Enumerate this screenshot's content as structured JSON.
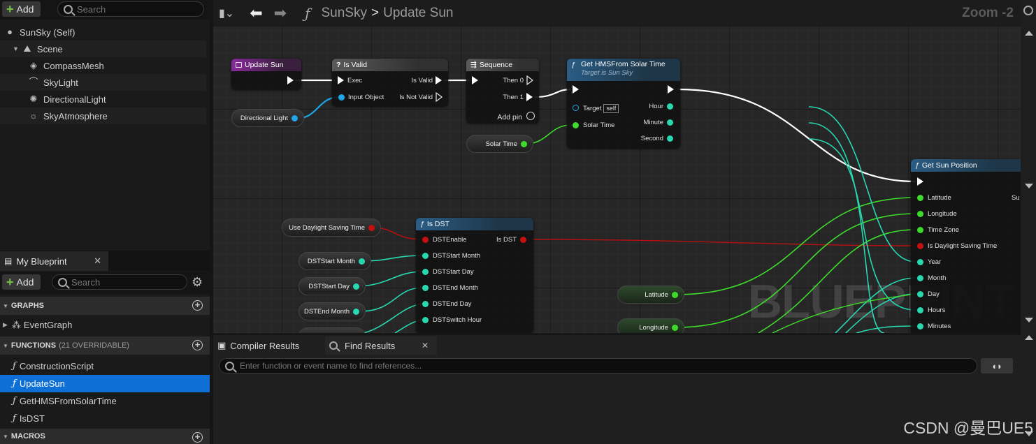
{
  "left_toolbar": {
    "add_label": "Add",
    "search_placeholder": "Search"
  },
  "components": [
    {
      "label": "SunSky (Self)",
      "icon": "person-icon"
    },
    {
      "label": "Scene",
      "icon": "scene-icon"
    },
    {
      "label": "CompassMesh",
      "icon": "cube-icon"
    },
    {
      "label": "SkyLight",
      "icon": "skylight-icon"
    },
    {
      "label": "DirectionalLight",
      "icon": "sun-icon"
    },
    {
      "label": "SkyAtmosphere",
      "icon": "atmosphere-icon"
    }
  ],
  "my_blueprint": {
    "tab_label": "My Blueprint",
    "add_label": "Add",
    "search_placeholder": "Search",
    "graphs_header": "GRAPHS",
    "graphs": [
      "EventGraph"
    ],
    "functions_header": "FUNCTIONS",
    "functions_sub": "(21 OVERRIDABLE)",
    "functions": [
      "ConstructionScript",
      "UpdateSun",
      "GetHMSFromSolarTime",
      "IsDST"
    ],
    "macros_header": "MACROS"
  },
  "graph_toolbar": {
    "crumb_root": "SunSky",
    "crumb_sep": ">",
    "crumb_current": "Update Sun",
    "zoom": "Zoom -2"
  },
  "nodes": {
    "update_sun": {
      "title": "Update Sun"
    },
    "is_valid": {
      "title": "Is Valid",
      "exec": "Exec",
      "input_object": "Input Object",
      "is_valid": "Is Valid",
      "is_not_valid": "Is Not Valid"
    },
    "sequence": {
      "title": "Sequence",
      "then0": "Then 0",
      "then1": "Then 1",
      "add_pin": "Add pin"
    },
    "get_hms": {
      "title": "Get HMSFrom Solar Time",
      "subtitle": "Target is Sun Sky",
      "target": "Target",
      "self": "self",
      "solar_time": "Solar Time",
      "hour": "Hour",
      "minute": "Minute",
      "second": "Second"
    },
    "is_dst": {
      "title": "Is DST",
      "dst_enable": "DSTEnable",
      "is_dst": "Is DST",
      "start_month": "DSTStart Month",
      "start_day": "DSTStart Day",
      "end_month": "DSTEnd Month",
      "end_day": "DSTEnd Day",
      "switch_hour": "DSTSwitch Hour"
    },
    "get_sun_position": {
      "title": "Get Sun Position",
      "latitude": "Latitude",
      "longitude": "Longitude",
      "time_zone": "Time Zone",
      "daylight": "Is Daylight Saving Time",
      "year": "Year",
      "month": "Month",
      "day": "Day",
      "hours": "Hours",
      "minutes": "Minutes",
      "out_partial": "Su"
    }
  },
  "variables": {
    "directional_light": "Directional Light",
    "solar_time": "Solar Time",
    "use_dst": "Use Daylight Saving Time",
    "dst_start_month": "DSTStart Month",
    "dst_start_day": "DSTStart Day",
    "dst_end_month": "DSTEnd Month",
    "latitude": "Latitude",
    "longitude": "Longitude"
  },
  "watermark": "BLUEPRINT",
  "bottom_panel": {
    "tab_compiler": "Compiler Results",
    "tab_find": "Find Results",
    "find_placeholder": "Enter function or event name to find references..."
  },
  "overlay_text": "CSDN @曼巴UE5",
  "colors": {
    "exec": "#ffffff",
    "object": "#1fa6e8",
    "float": "#3edb2c",
    "int": "#28d8b0",
    "bool": "#c61010",
    "selected": "#0e6fd6"
  }
}
